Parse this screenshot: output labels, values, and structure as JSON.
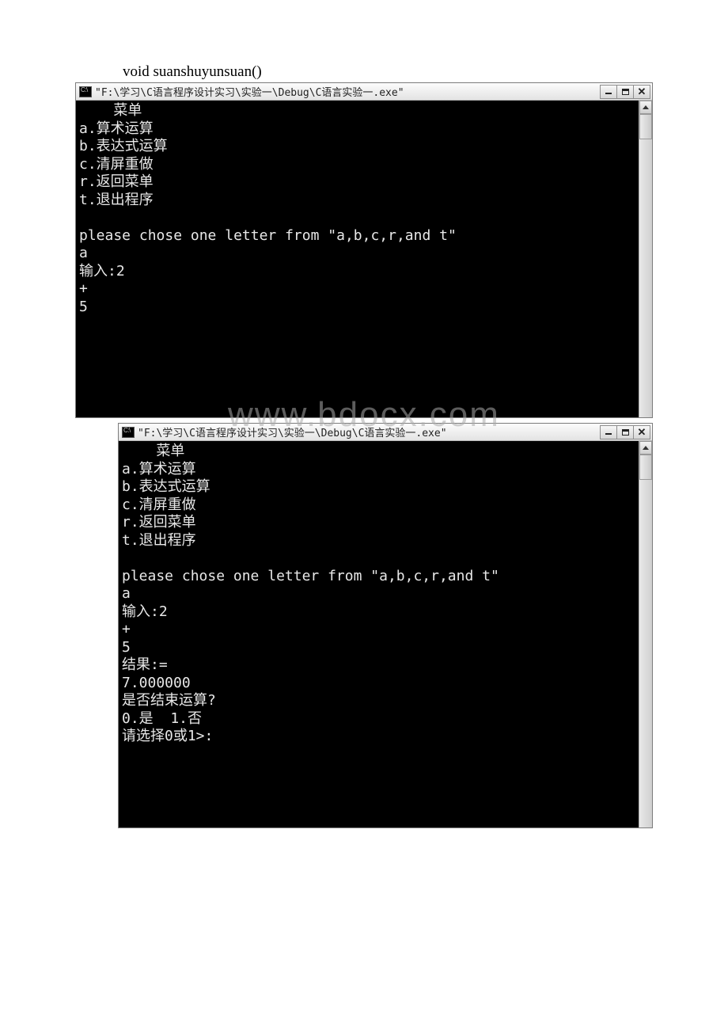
{
  "heading": "void suanshuyunsuan()",
  "watermark_text": "www.bdocx.com",
  "window1": {
    "title": "\"F:\\学习\\C语言程序设计实习\\实验一\\Debug\\C语言实验一.exe\"",
    "lines": [
      "    菜单",
      "a.算术运算",
      "b.表达式运算",
      "c.清屏重做",
      "r.返回菜单",
      "t.退出程序",
      "",
      "please chose one letter from \"a,b,c,r,and t\"",
      "a",
      "输入:2",
      "+",
      "5"
    ]
  },
  "window2": {
    "title": "\"F:\\学习\\C语言程序设计实习\\实验一\\Debug\\C语言实验一.exe\"",
    "lines": [
      "    菜单",
      "a.算术运算",
      "b.表达式运算",
      "c.清屏重做",
      "r.返回菜单",
      "t.退出程序",
      "",
      "please chose one letter from \"a,b,c,r,and t\"",
      "a",
      "输入:2",
      "+",
      "5",
      "结果:=",
      "7.000000",
      "是否结束运算?",
      "0.是  1.否",
      "请选择0或1>:"
    ]
  },
  "buttons": {
    "minimize": "_",
    "maximize": "□",
    "close": "✕"
  }
}
